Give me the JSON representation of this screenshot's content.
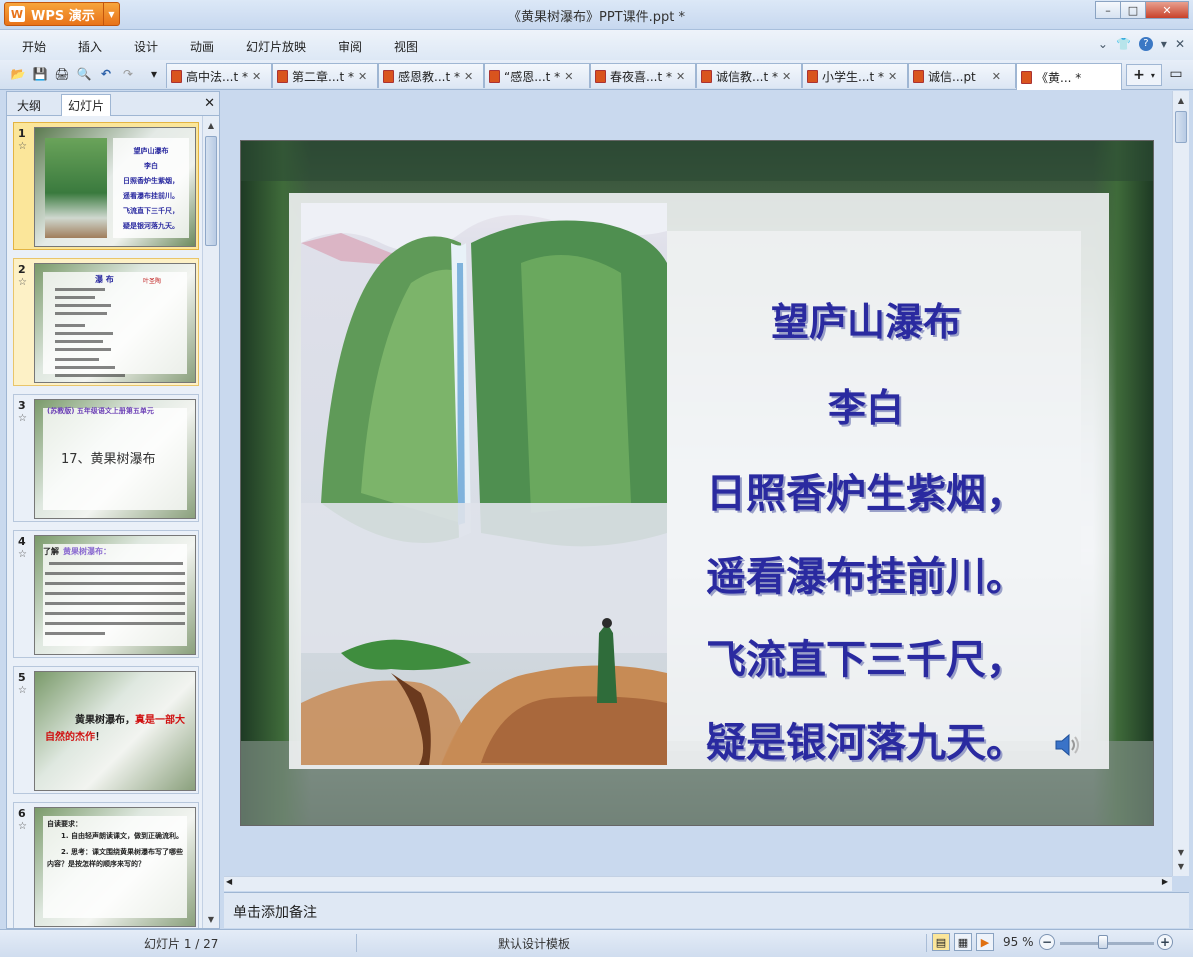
{
  "app": {
    "name": "WPS 演示",
    "logo": "W",
    "window_title": "《黄果树瀑布》PPT课件.ppt *"
  },
  "window_controls": {
    "minimize": "–",
    "maximize": "□",
    "close": "✕"
  },
  "menu": [
    "开始",
    "插入",
    "设计",
    "动画",
    "幻灯片放映",
    "审阅",
    "视图"
  ],
  "menu_right": {
    "chevron": "⌄",
    "skin": "👕",
    "help": "?"
  },
  "quick_access": {
    "open": "📂",
    "save": "💾",
    "print": "🖨",
    "preview": "🔍",
    "undo": "↶",
    "redo": "↷",
    "more": "▾"
  },
  "doc_tabs": [
    {
      "title": "高中法...t *",
      "close": "✕"
    },
    {
      "title": "第二章...t *",
      "close": "✕"
    },
    {
      "title": "感恩教...t *",
      "close": "✕"
    },
    {
      "title": "“感恩...t *",
      "close": "✕"
    },
    {
      "title": "春夜喜...t *",
      "close": "✕"
    },
    {
      "title": "诚信教...t *",
      "close": "✕"
    },
    {
      "title": "小学生...t *",
      "close": "✕"
    },
    {
      "title": "诚信...pt",
      "close": "✕"
    },
    {
      "title": "《黄... *",
      "close": ""
    }
  ],
  "new_tab": "+",
  "sidebar": {
    "tabs": [
      "大纲",
      "幻灯片"
    ],
    "active_tab": "幻灯片",
    "close": "✕",
    "thumbnails": [
      {
        "num": "1",
        "lines": [
          "望庐山瀑布",
          "李白",
          "日照香炉生紫烟，",
          "遥看瀑布挂前川。",
          "飞流直下三千尺，",
          "疑是银河落九天。"
        ]
      },
      {
        "num": "2",
        "title": "瀑  布",
        "subtitle": "叶圣陶"
      },
      {
        "num": "3",
        "banner": "(苏教版) 五年级语文上册第五单元",
        "title": "17、黄果树瀑布"
      },
      {
        "num": "4",
        "label": "了解",
        "highlight": "黄果树瀑布："
      },
      {
        "num": "5",
        "black": "黄果树瀑布，",
        "red": "真是一部大自然的杰作",
        "end": "！"
      },
      {
        "num": "6",
        "title": "自读要求：",
        "item1": "1. 自由轻声朗读课文，做到正确流利。",
        "item2": "2. 思考：课文围绕黄果树瀑布写了哪些内容？是按怎样的顺序来写的？"
      }
    ],
    "star": "☆"
  },
  "slide": {
    "title": "望庐山瀑布",
    "author": "李白",
    "lines": [
      "日照香炉生紫烟，",
      "遥看瀑布挂前川。",
      "飞流直下三千尺，",
      "疑是银河落九天。"
    ],
    "speaker_icon": "speaker-icon"
  },
  "notes": {
    "placeholder": "单击添加备注"
  },
  "status": {
    "slide_count": "幻灯片 1 / 27",
    "template": "默认设计模板",
    "zoom": "95 %",
    "zoom_minus": "−",
    "zoom_plus": "+"
  }
}
